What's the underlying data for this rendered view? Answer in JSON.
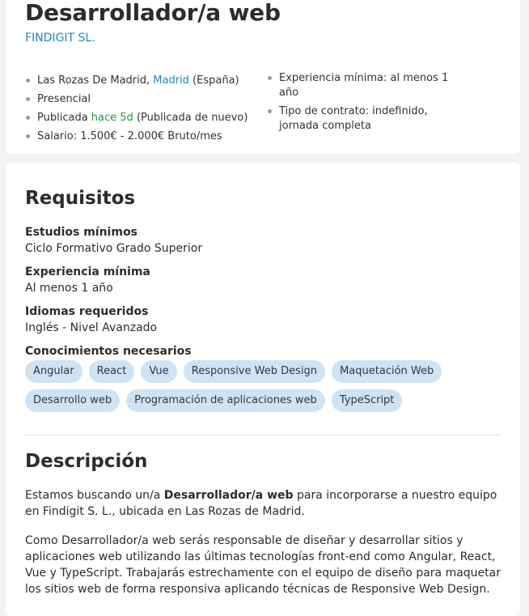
{
  "job": {
    "title": "Desarrollador/a web",
    "company": "FINDIGIT SL."
  },
  "details": {
    "location_prefix": "Las Rozas De Madrid, ",
    "location_link": "Madrid",
    "location_suffix": " (España)",
    "modality": "Presencial",
    "published_prefix": "Publicada ",
    "published_link": "hace 5d",
    "published_suffix": " (Publicada de nuevo)",
    "salary": "Salario: 1.500€ - 2.000€ Bruto/mes",
    "experience": "Experiencia mínima: al menos 1 año",
    "contract": "Tipo de contrato: indefinido, jornada completa"
  },
  "requirements": {
    "heading": "Requisitos",
    "studies_label": "Estudios mínimos",
    "studies_value": "Ciclo Formativo Grado Superior",
    "experience_label": "Experiencia mínima",
    "experience_value": "Al menos 1 año",
    "languages_label": "Idiomas requeridos",
    "languages_value": "Inglés - Nivel Avanzado",
    "skills_label": "Conocimientos necesarios",
    "skills": [
      "Angular",
      "React",
      "Vue",
      "Responsive Web Design",
      "Maquetación Web",
      "Desarrollo web",
      "Programación de aplicaciones web",
      "TypeScript"
    ]
  },
  "description": {
    "heading": "Descripción",
    "p1_pre": "Estamos buscando un/a ",
    "p1_bold": "Desarrollador/a web",
    "p1_post": " para incorporarse a nuestro equipo en Findigit S. L., ubicada en Las Rozas de Madrid.",
    "p2": "Como Desarrollador/a web serás responsable de diseñar y desarrollar sitios y aplicaciones web utilizando las últimas tecnologías front-end como Angular, React, Vue y TypeScript. Trabajarás estrechamente con el equipo de diseño para maquetar los sitios web de forma responsiva aplicando técnicas de Responsive Web Design."
  }
}
